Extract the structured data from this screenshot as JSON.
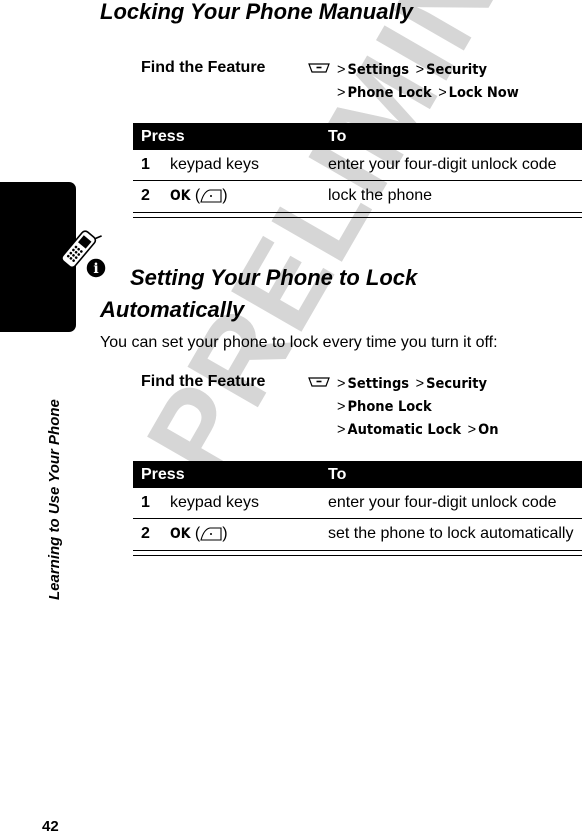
{
  "page": {
    "number": "42",
    "side_title": "Learning to Use Your Phone",
    "watermark": "PRELIMINARY"
  },
  "section1": {
    "title": "Locking Your Phone Manually",
    "find_feature": {
      "label": "Find the Feature",
      "key_icon": "menu-key-icon",
      "path": [
        "Settings",
        "Security",
        "Phone Lock",
        "Lock Now"
      ]
    },
    "table": {
      "headers": [
        "Press",
        "To"
      ],
      "rows": [
        {
          "num": "1",
          "press": "keypad keys",
          "to": "enter your four-digit unlock code"
        },
        {
          "num": "2",
          "press": "OK",
          "press_icon": "right-soft-key-icon",
          "to": "lock the phone"
        }
      ]
    }
  },
  "section2": {
    "title_line1": "Setting Your Phone to Lock",
    "title_line2": "Automatically",
    "intro": "You can set your phone to lock every time you turn it off:",
    "find_feature": {
      "label": "Find the Feature",
      "key_icon": "menu-key-icon",
      "path": [
        "Settings",
        "Security",
        "Phone Lock",
        "Automatic Lock",
        "On"
      ]
    },
    "table": {
      "headers": [
        "Press",
        "To"
      ],
      "rows": [
        {
          "num": "1",
          "press": "keypad keys",
          "to": "enter your four-digit unlock code"
        },
        {
          "num": "2",
          "press": "OK",
          "press_icon": "right-soft-key-icon",
          "to": "set the phone to lock automatically"
        }
      ]
    }
  },
  "gt": ">",
  "paren_open": "(",
  "paren_close": ")"
}
